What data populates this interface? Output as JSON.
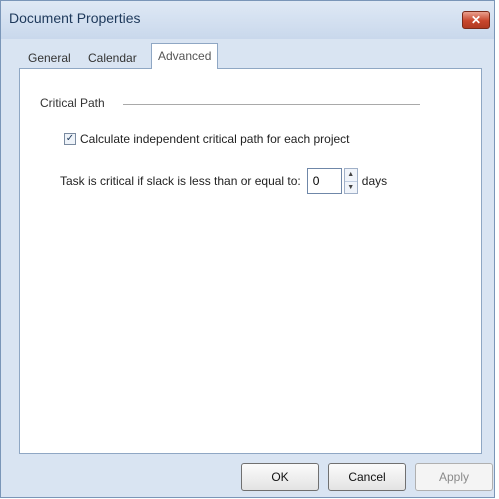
{
  "window": {
    "title": "Document Properties",
    "close_glyph": "✕"
  },
  "tabs": [
    {
      "label": "General"
    },
    {
      "label": "Calendar"
    },
    {
      "label": "Advanced",
      "selected": true
    }
  ],
  "critical_path": {
    "group_label": "Critical Path",
    "checkbox_label": "Calculate independent critical path for each project",
    "checkbox_checked": true,
    "checkbox_glyph": "✓",
    "slack_label": "Task is critical if slack is less than or equal to:",
    "slack_value": "0",
    "spin_up_glyph": "▲",
    "spin_down_glyph": "▼",
    "unit_label": "days"
  },
  "buttons": {
    "ok": "OK",
    "cancel": "Cancel",
    "apply": "Apply"
  },
  "icons": {
    "close": "close-icon",
    "check": "checkmark-icon",
    "spin_up": "chevron-up-icon",
    "spin_down": "chevron-down-icon"
  }
}
